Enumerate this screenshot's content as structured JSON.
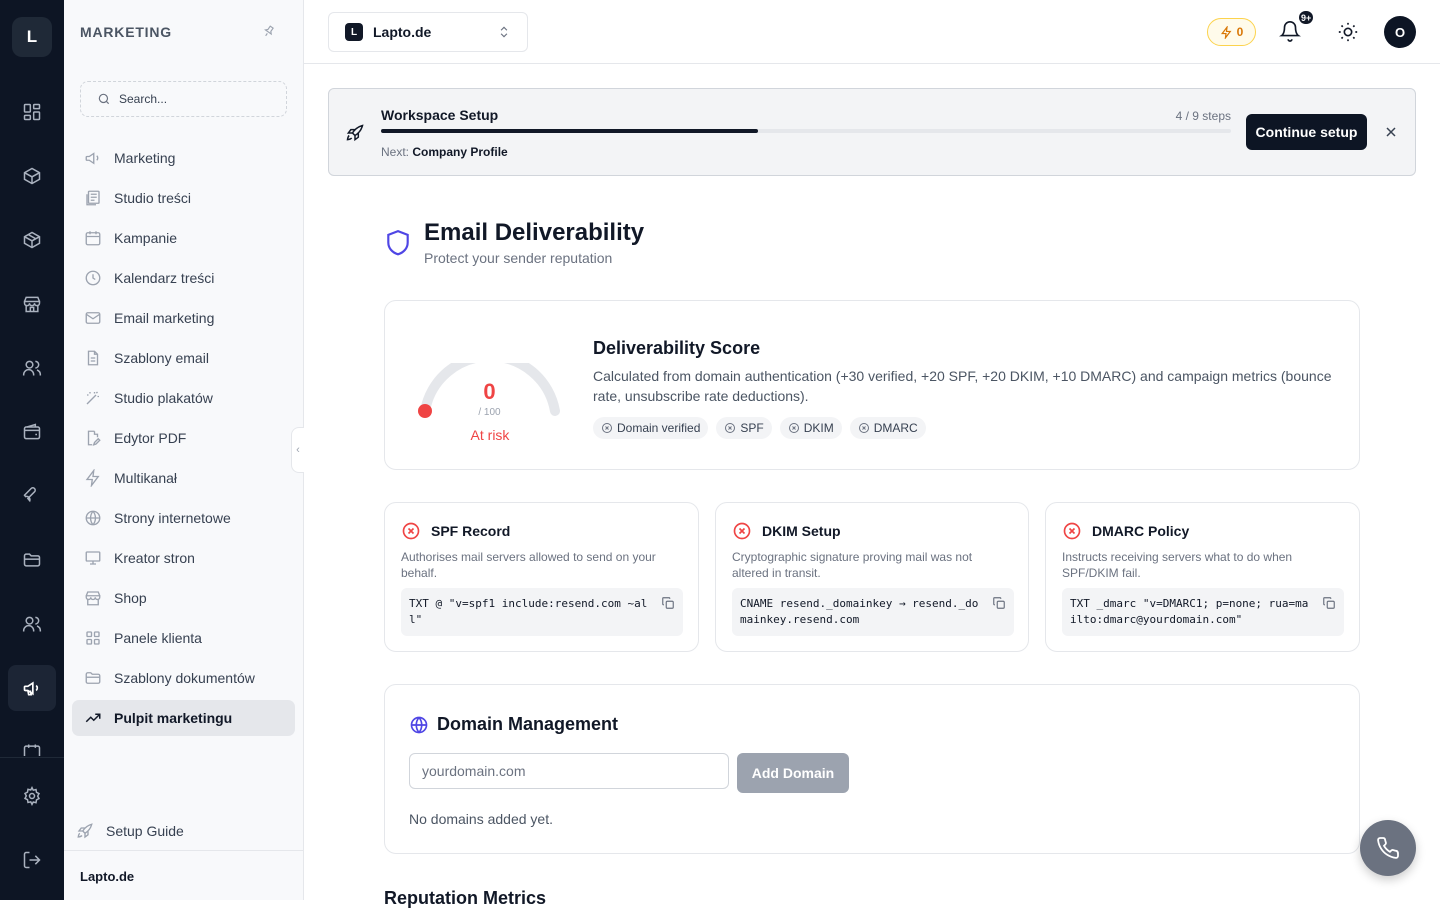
{
  "rail": {
    "logo": "L",
    "items": [
      "dashboard-icon",
      "box-icon",
      "package-icon",
      "store-icon",
      "users-icon",
      "wallet-icon",
      "wrench-icon",
      "folder-icon",
      "team-icon",
      "megaphone-icon",
      "calendar-icon"
    ],
    "active": "megaphone-icon",
    "bottom": [
      "settings-icon",
      "logout-icon"
    ]
  },
  "sidebar": {
    "title": "MARKETING",
    "search_placeholder": "Search...",
    "items": [
      {
        "label": "Marketing",
        "icon": "megaphone-icon"
      },
      {
        "label": "Studio treści",
        "icon": "layers-icon"
      },
      {
        "label": "Kampanie",
        "icon": "calendar-icon"
      },
      {
        "label": "Kalendarz treści",
        "icon": "clock-icon"
      },
      {
        "label": "Email marketing",
        "icon": "mail-icon"
      },
      {
        "label": "Szablony email",
        "icon": "file-text-icon"
      },
      {
        "label": "Studio plakatów",
        "icon": "wand-icon"
      },
      {
        "label": "Edytor PDF",
        "icon": "file-edit-icon"
      },
      {
        "label": "Multikanał",
        "icon": "zap-icon"
      },
      {
        "label": "Strony internetowe",
        "icon": "globe-icon"
      },
      {
        "label": "Kreator stron",
        "icon": "monitor-icon"
      },
      {
        "label": "Shop",
        "icon": "store-icon"
      },
      {
        "label": "Panele klienta",
        "icon": "grid-icon"
      },
      {
        "label": "Szablony dokumentów",
        "icon": "folder-icon"
      },
      {
        "label": "Pulpit marketingu",
        "icon": "trending-up-icon",
        "active": true
      }
    ],
    "setup_guide": "Setup Guide",
    "footer": "Lapto.de"
  },
  "topbar": {
    "workspace_badge": "L",
    "workspace": "Lapto.de",
    "credits": "0",
    "notifications_badge": "9+",
    "avatar": "O"
  },
  "setup": {
    "title": "Workspace Setup",
    "steps": "4 / 9 steps",
    "progress": 0.444,
    "next_label": "Next:",
    "next_value": "Company Profile",
    "button": "Continue setup"
  },
  "page": {
    "title": "Email Deliverability",
    "subtitle": "Protect your sender reputation"
  },
  "score": {
    "value": "0",
    "max": "/ 100",
    "status": "At risk",
    "title": "Deliverability Score",
    "description": "Calculated from domain authentication (+30 verified, +20 SPF, +20 DKIM, +10 DMARC) and campaign metrics (bounce rate, unsubscribe rate deductions).",
    "chips": [
      "Domain verified",
      "SPF",
      "DKIM",
      "DMARC"
    ],
    "status_color": "#ef4444"
  },
  "records": [
    {
      "title": "SPF Record",
      "description": "Authorises mail servers allowed to send on your behalf.",
      "code": "TXT @ \"v=spf1 include:resend.com ~all\""
    },
    {
      "title": "DKIM Setup",
      "description": "Cryptographic signature proving mail was not altered in transit.",
      "code": "CNAME resend._domainkey → resend._domainkey.resend.com"
    },
    {
      "title": "DMARC Policy",
      "description": "Instructs receiving servers what to do when SPF/DKIM fail.",
      "code": "TXT _dmarc \"v=DMARC1; p=none; rua=mailto:dmarc@yourdomain.com\""
    }
  ],
  "domains": {
    "title": "Domain Management",
    "placeholder": "yourdomain.com",
    "button": "Add Domain",
    "empty": "No domains added yet."
  },
  "reputation_title": "Reputation Metrics",
  "colors": {
    "accent": "#4f46e5",
    "danger": "#ef4444",
    "dark": "#0d1524"
  }
}
